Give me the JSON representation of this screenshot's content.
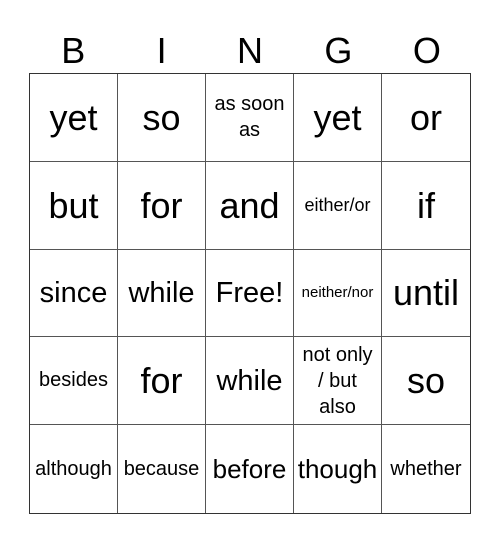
{
  "header": {
    "letters": [
      "B",
      "I",
      "N",
      "G",
      "O"
    ]
  },
  "cells": [
    {
      "text": "yet",
      "size": "s36"
    },
    {
      "text": "so",
      "size": "s36"
    },
    {
      "text": "as soon as",
      "size": "ml"
    },
    {
      "text": "yet",
      "size": "s36"
    },
    {
      "text": "or",
      "size": "s36"
    },
    {
      "text": "but",
      "size": "s36"
    },
    {
      "text": "for",
      "size": "s36"
    },
    {
      "text": "and",
      "size": "s36"
    },
    {
      "text": "either/or",
      "size": "s18"
    },
    {
      "text": "if",
      "size": "s36"
    },
    {
      "text": "since",
      "size": "s30"
    },
    {
      "text": "while",
      "size": "s30"
    },
    {
      "text": "Free!",
      "size": "s30"
    },
    {
      "text": "neither/nor",
      "size": "s15"
    },
    {
      "text": "until",
      "size": "s36"
    },
    {
      "text": "besides",
      "size": "s20"
    },
    {
      "text": "for",
      "size": "s36"
    },
    {
      "text": "while",
      "size": "s30"
    },
    {
      "text": "not only / but also",
      "size": "ml"
    },
    {
      "text": "so",
      "size": "s36"
    },
    {
      "text": "although",
      "size": "s20"
    },
    {
      "text": "because",
      "size": "s20"
    },
    {
      "text": "before",
      "size": "s26"
    },
    {
      "text": "though",
      "size": "s26"
    },
    {
      "text": "whether",
      "size": "s20"
    }
  ]
}
